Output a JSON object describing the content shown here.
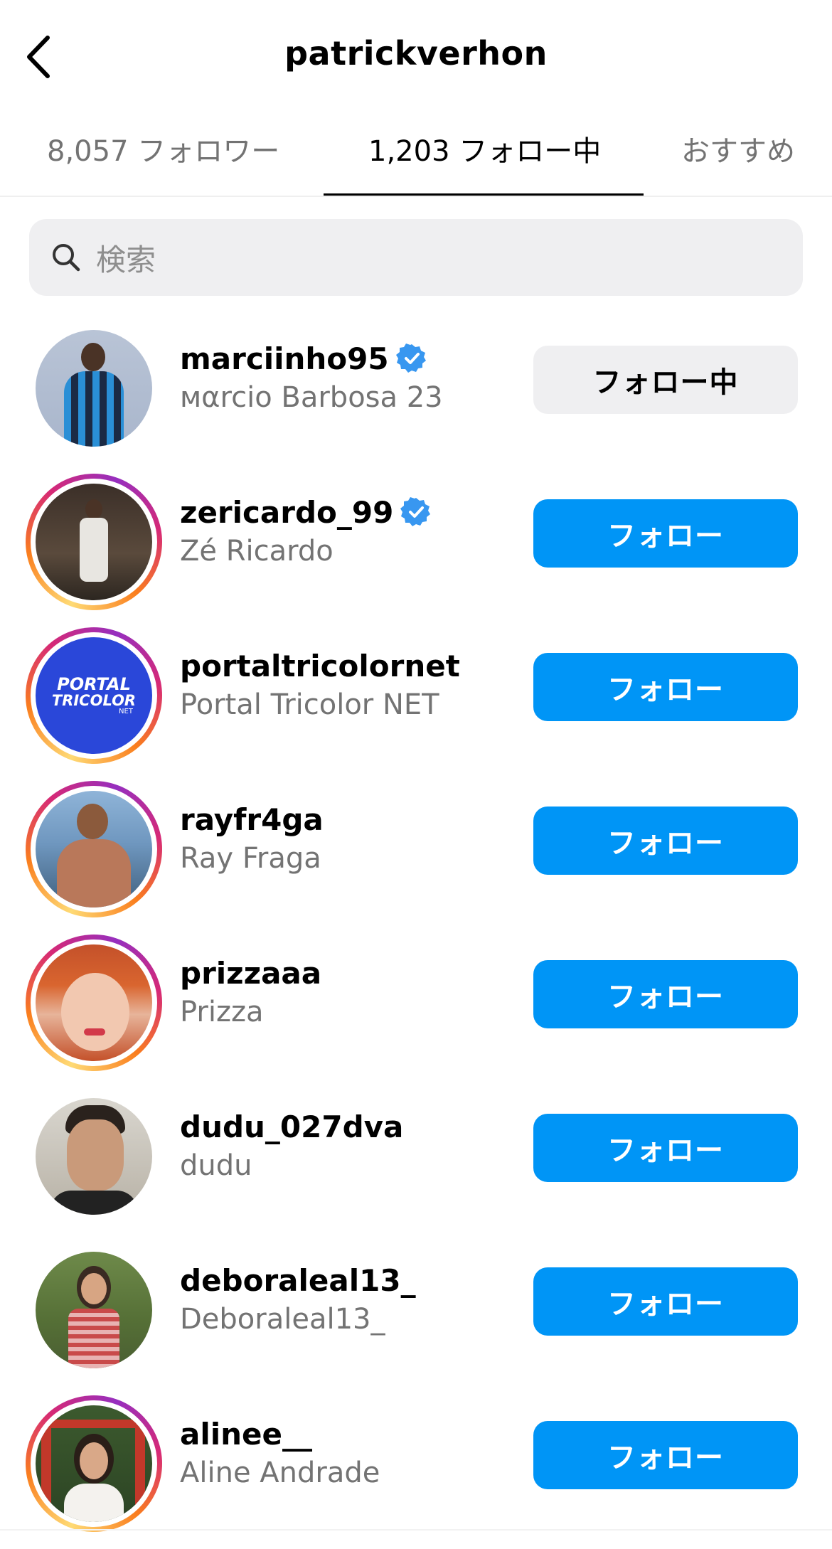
{
  "header": {
    "title": "patrickverhon"
  },
  "tabs": [
    {
      "label": "8,057 フォロワー",
      "active": false
    },
    {
      "label": "1,203 フォロー中",
      "active": true
    },
    {
      "label": "おすすめ",
      "active": false
    }
  ],
  "search": {
    "placeholder": "検索"
  },
  "colors": {
    "follow_button": "#0095f6",
    "following_button": "#efeff1",
    "verified_badge": "#3897f0",
    "secondary_text": "#737373"
  },
  "users": [
    {
      "username": "marciinho95",
      "full_name": "ᴍαrcio Barbosa 23",
      "verified": true,
      "story_ring": false,
      "button": "フォロー中",
      "avatar": "avatar-photo"
    },
    {
      "username": "zericardo_99",
      "full_name": "Zé Ricardo",
      "verified": true,
      "story_ring": true,
      "button": "フォロー",
      "avatar": "avatar-photo"
    },
    {
      "username": "portaltricolornet",
      "full_name": "Portal Tricolor NET",
      "verified": false,
      "story_ring": true,
      "button": "フォロー",
      "avatar": "logo",
      "logo_line1": "PORTAL",
      "logo_line2": "TRICOLOR",
      "logo_suffix": "NET"
    },
    {
      "username": "rayfr4ga",
      "full_name": "Ray Fraga",
      "verified": false,
      "story_ring": true,
      "button": "フォロー",
      "avatar": "avatar-photo"
    },
    {
      "username": "prizzaaa",
      "full_name": "Prizza",
      "verified": false,
      "story_ring": true,
      "button": "フォロー",
      "avatar": "avatar-photo"
    },
    {
      "username": "dudu_027dva",
      "full_name": "dudu",
      "verified": false,
      "story_ring": false,
      "button": "フォロー",
      "avatar": "avatar-photo"
    },
    {
      "username": "deboraleal13_",
      "full_name": "Deboraleal13_",
      "verified": false,
      "story_ring": false,
      "button": "フォロー",
      "avatar": "avatar-photo"
    },
    {
      "username": "alinee__",
      "full_name": "Aline Andrade",
      "verified": false,
      "story_ring": true,
      "button": "フォロー",
      "avatar": "avatar-photo"
    }
  ]
}
